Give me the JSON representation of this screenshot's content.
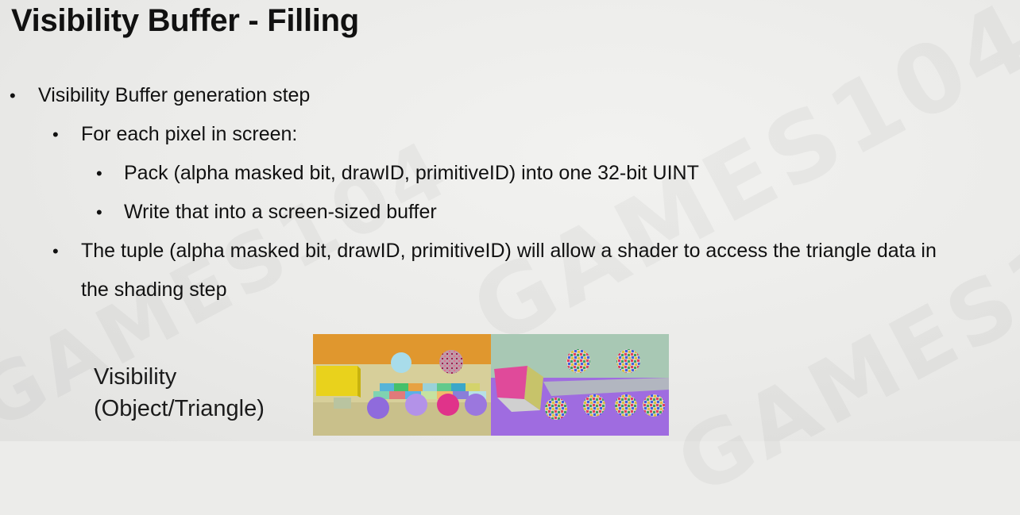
{
  "slide": {
    "title": "Visibility Buffer - Filling",
    "bullets": {
      "main": "Visibility Buffer generation step",
      "sub1": "For each pixel in screen:",
      "sub1_items": [
        "Pack (alpha masked bit, drawID, primitiveID) into one 32-bit UINT",
        "Write that into a screen-sized buffer"
      ],
      "sub2_line1": "The tuple (alpha masked bit, drawID, primitiveID) will allow a  shader to access the triangle data in",
      "sub2_line2": "the shading step"
    },
    "figure": {
      "caption_line1": "Visibility",
      "caption_line2": "(Object/Triangle)"
    },
    "watermark": "GAMES104",
    "colors": {
      "background": "#ececea",
      "text": "#111111"
    }
  }
}
